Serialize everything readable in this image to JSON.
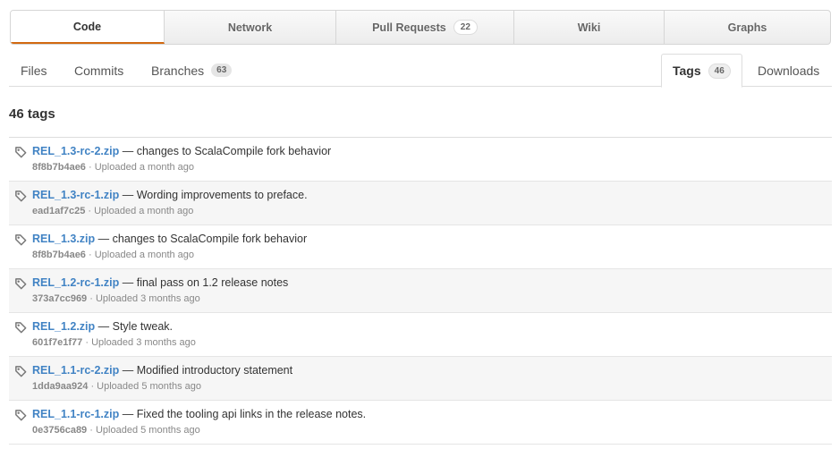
{
  "topnav": {
    "code": "Code",
    "network": "Network",
    "pull_requests": "Pull Requests",
    "pull_requests_count": "22",
    "wiki": "Wiki",
    "graphs": "Graphs"
  },
  "subnav": {
    "files": "Files",
    "commits": "Commits",
    "branches": "Branches",
    "branches_count": "63",
    "tags": "Tags",
    "tags_count": "46",
    "downloads": "Downloads"
  },
  "heading": "46 tags",
  "tags": [
    {
      "name": "REL_1.3-rc-2.zip",
      "message": "changes to ScalaCompile fork behavior",
      "sha": "8f8b7b4ae6",
      "uploaded": "Uploaded a month ago"
    },
    {
      "name": "REL_1.3-rc-1.zip",
      "message": "Wording improvements to preface.",
      "sha": "ead1af7c25",
      "uploaded": "Uploaded a month ago"
    },
    {
      "name": "REL_1.3.zip",
      "message": "changes to ScalaCompile fork behavior",
      "sha": "8f8b7b4ae6",
      "uploaded": "Uploaded a month ago"
    },
    {
      "name": "REL_1.2-rc-1.zip",
      "message": "final pass on 1.2 release notes",
      "sha": "373a7cc969",
      "uploaded": "Uploaded 3 months ago"
    },
    {
      "name": "REL_1.2.zip",
      "message": "Style tweak.",
      "sha": "601f7e1f77",
      "uploaded": "Uploaded 3 months ago"
    },
    {
      "name": "REL_1.1-rc-2.zip",
      "message": "Modified introductory statement",
      "sha": "1dda9aa924",
      "uploaded": "Uploaded 5 months ago"
    },
    {
      "name": "REL_1.1-rc-1.zip",
      "message": "Fixed the tooling api links in the release notes.",
      "sha": "0e3756ca89",
      "uploaded": "Uploaded 5 months ago"
    }
  ],
  "colors": {
    "accent": "#d26911",
    "link": "#4183c4"
  },
  "icons": {
    "tag": "tag-icon"
  }
}
